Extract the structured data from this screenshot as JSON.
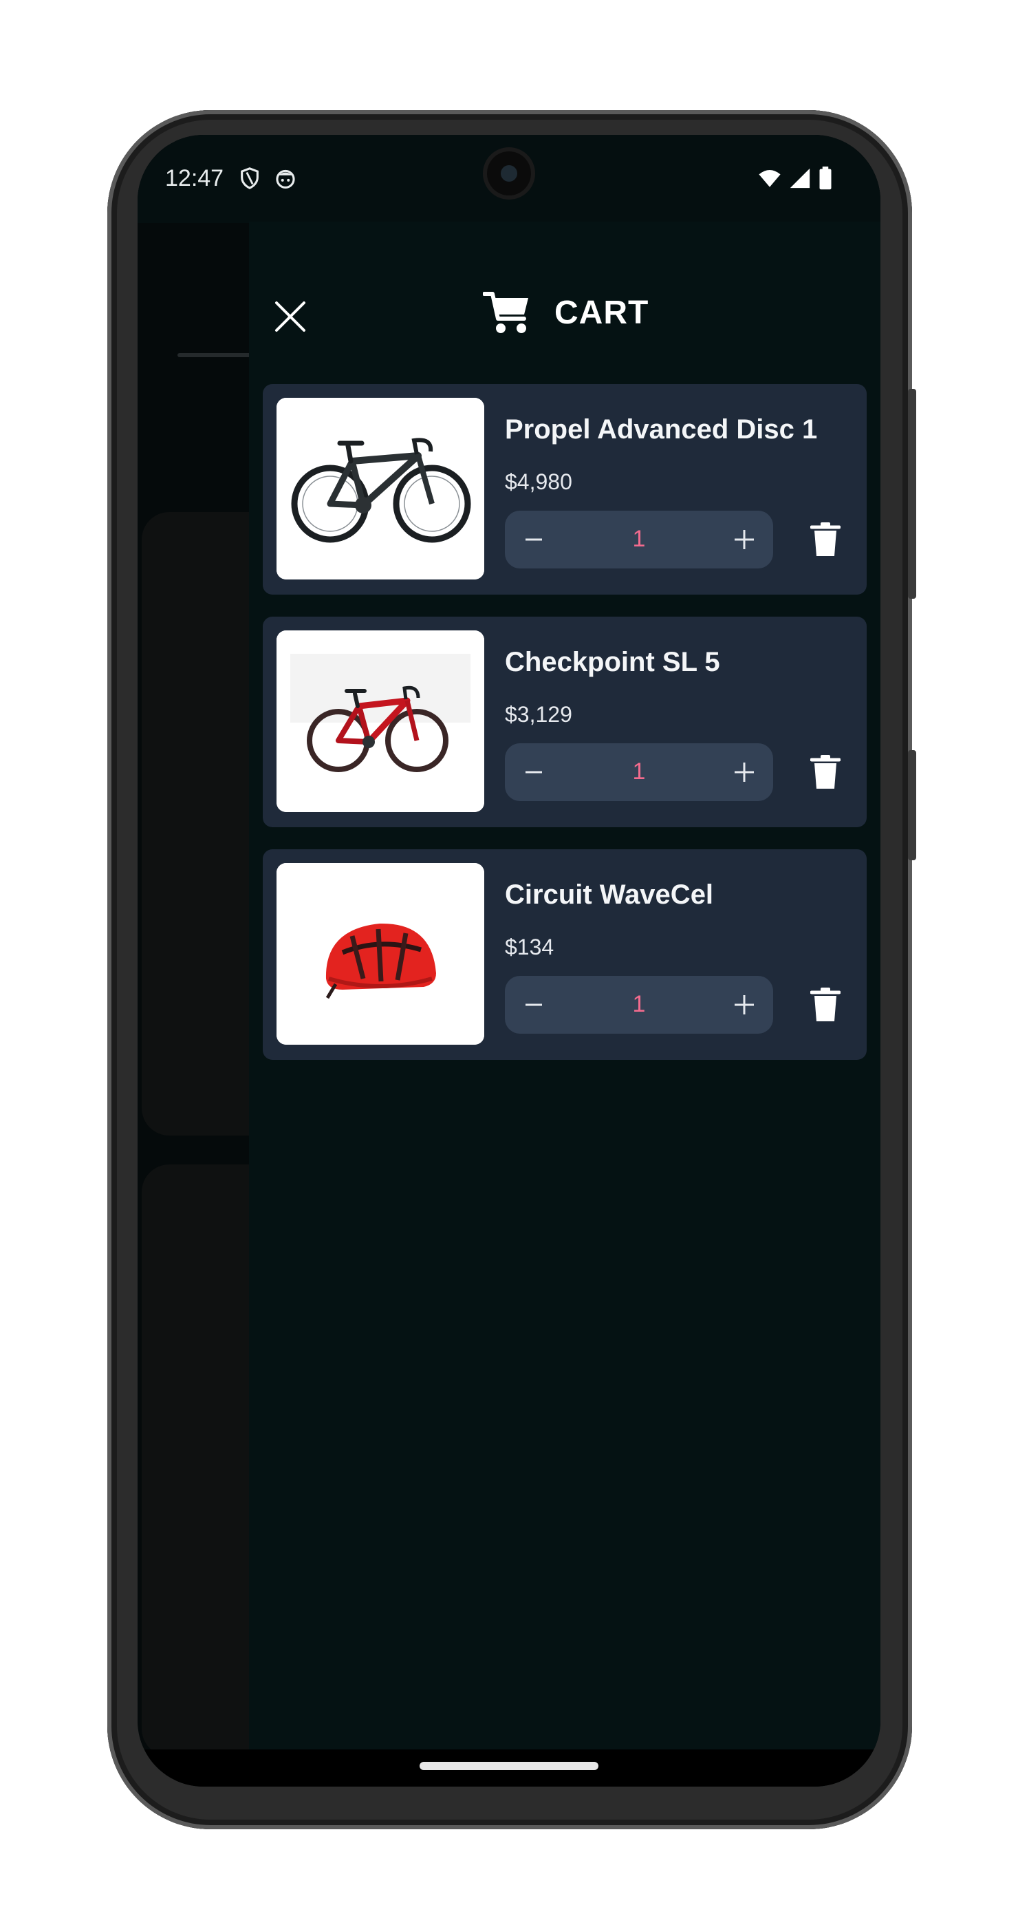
{
  "status_bar": {
    "time": "12:47",
    "left_icons": [
      "shield-icon",
      "cat-face-icon"
    ],
    "right_icons": [
      "wifi-icon",
      "cell-signal-icon",
      "battery-icon"
    ]
  },
  "cart": {
    "title": "CART",
    "header_icon": "cart-icon",
    "close_icon": "close-icon",
    "items": [
      {
        "name": "Propel Advanced Disc 1",
        "price": "$4,980",
        "quantity": "1",
        "image": "black road bike"
      },
      {
        "name": "Checkpoint SL 5",
        "price": "$3,129",
        "quantity": "1",
        "image": "red gravel bike"
      },
      {
        "name": "Circuit WaveCel",
        "price": "$134",
        "quantity": "1",
        "image": "red cycling helmet"
      }
    ]
  },
  "colors": {
    "drawer_bg": "#051213",
    "card_bg": "#1f2a3a",
    "stepper_bg": "#334155",
    "quantity_text": "#f36b8e"
  }
}
